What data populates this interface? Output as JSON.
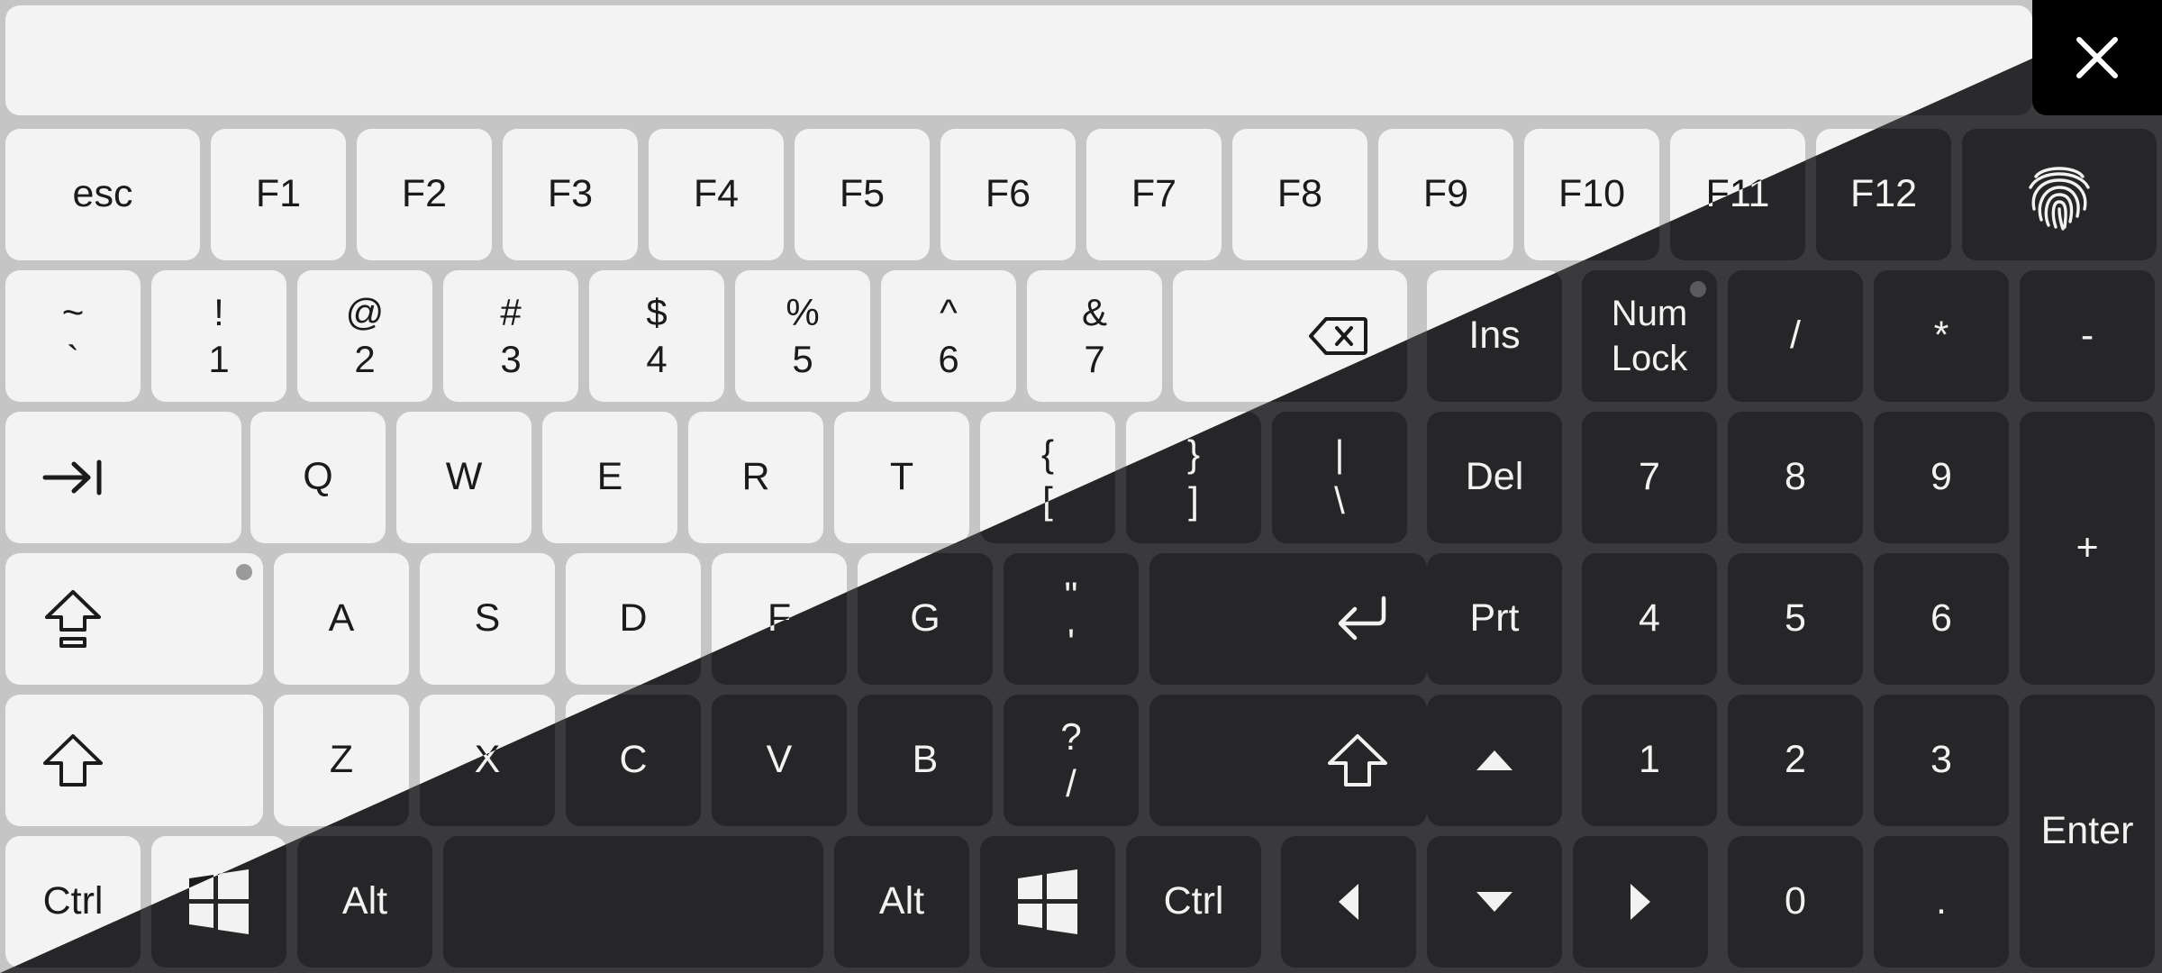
{
  "keyboard": {
    "close_icon": "close-icon",
    "fingerprint_icon": "fingerprint-icon",
    "row_fn": [
      "esc",
      "F1",
      "F2",
      "F3",
      "F4",
      "F5",
      "F6",
      "F7",
      "F8",
      "F9",
      "F10",
      "F11",
      "F12"
    ],
    "row_num": [
      {
        "top": "~",
        "bottom": "`"
      },
      {
        "top": "!",
        "bottom": "1"
      },
      {
        "top": "@",
        "bottom": "2"
      },
      {
        "top": "#",
        "bottom": "3"
      },
      {
        "top": "$",
        "bottom": "4"
      },
      {
        "top": "%",
        "bottom": "5"
      },
      {
        "top": "^",
        "bottom": "6"
      },
      {
        "top": "&",
        "bottom": "7"
      }
    ],
    "backspace_icon": "backspace-icon",
    "nav": {
      "ins": "Ins",
      "del": "Del",
      "prt": "Prt"
    },
    "numlock": {
      "top": "Num",
      "bottom": "Lock"
    },
    "row_q": [
      "Q",
      "W",
      "E",
      "R",
      "T"
    ],
    "brackets": [
      {
        "top": "{",
        "bottom": "["
      },
      {
        "top": "}",
        "bottom": "]"
      },
      {
        "top": "|",
        "bottom": "\\"
      }
    ],
    "tab_icon": "tab-icon",
    "capslock_icon": "caps-lock-icon",
    "row_a": [
      "A",
      "S",
      "D",
      "F",
      "G"
    ],
    "quote": {
      "top": "\"",
      "bottom": "'"
    },
    "enter_icon": "enter-icon",
    "shift_icon": "shift-icon",
    "row_z": [
      "Z",
      "X",
      "C",
      "V",
      "B"
    ],
    "slash": {
      "top": "?",
      "bottom": "/"
    },
    "bottom_row": {
      "ctrl": "Ctrl",
      "alt": "Alt"
    },
    "numpad": {
      "divide": "/",
      "multiply": "*",
      "minus": "-",
      "plus": "+",
      "n7": "7",
      "n8": "8",
      "n9": "9",
      "n4": "4",
      "n5": "5",
      "n6": "6",
      "n1": "1",
      "n2": "2",
      "n3": "3",
      "n0": "0",
      "dot": ".",
      "enter": "Enter"
    },
    "colors": {
      "light_key": "#f3f3f3",
      "light_bg": "#c5c5c5",
      "dark_key": "#262628",
      "dark_bg": "#3a3a3c"
    }
  }
}
